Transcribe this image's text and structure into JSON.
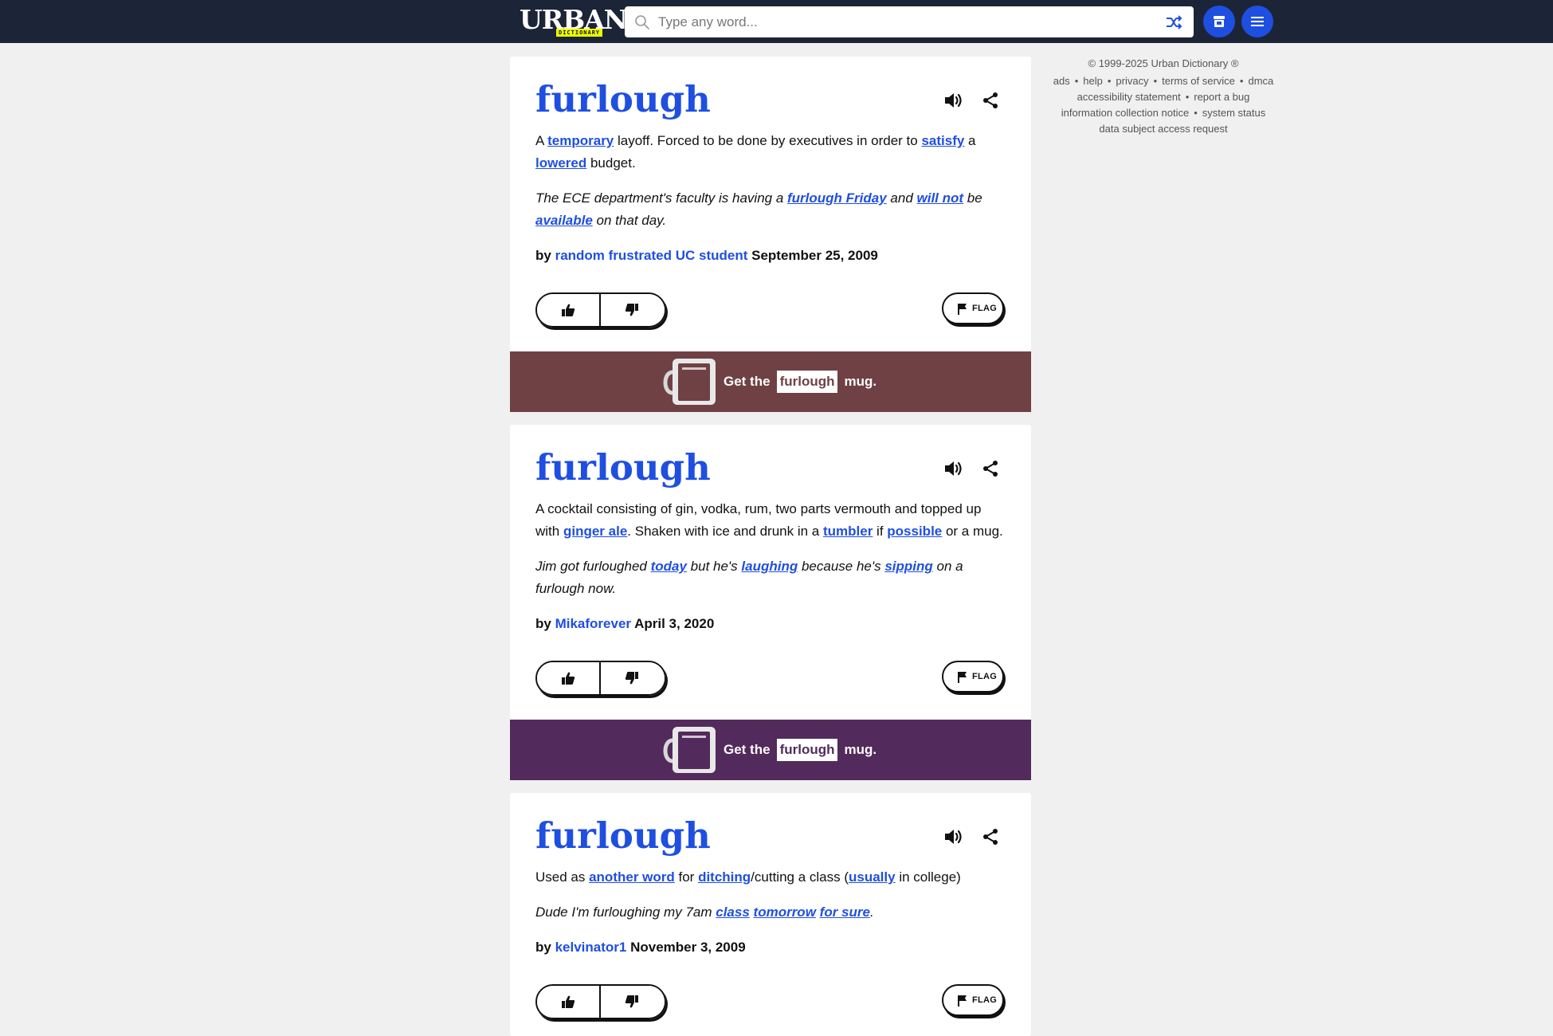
{
  "header": {
    "logo_text": "URBAN",
    "logo_sub": "DICTIONARY",
    "search_placeholder": "Type any word..."
  },
  "sidebar": {
    "copyright": "© 1999-2025 Urban Dictionary ®",
    "links": {
      "ads": "ads",
      "help": "help",
      "privacy": "privacy",
      "terms": "terms of service",
      "dmca": "dmca",
      "accessibility": "accessibility statement",
      "report_bug": "report a bug",
      "info_notice": "information collection notice",
      "system_status": "system status",
      "dsar": "data subject access request"
    },
    "separator": "•"
  },
  "definitions": [
    {
      "word": "furlough",
      "meaning": [
        {
          "t": "A "
        },
        {
          "link": "temporary"
        },
        {
          "t": " layoff. Forced to be done by executives in order to "
        },
        {
          "link": "satisfy"
        },
        {
          "t": " a "
        },
        {
          "link": "lowered"
        },
        {
          "t": " budget."
        }
      ],
      "example": [
        {
          "t": "The ECE department's faculty is having a "
        },
        {
          "link": "furlough Friday"
        },
        {
          "t": " and "
        },
        {
          "link": "will not"
        },
        {
          "t": " be "
        },
        {
          "link": "available"
        },
        {
          "t": " on that day."
        }
      ],
      "by": "by",
      "author": "random frustrated UC student",
      "date": "September 25, 2009",
      "flag_label": "FLAG",
      "mug": {
        "prefix": "Get the",
        "word": "furlough",
        "suffix": "mug.",
        "color": "#6f4144"
      }
    },
    {
      "word": "furlough",
      "meaning": [
        {
          "t": "A cocktail consisting of gin, vodka, rum, two parts vermouth and topped up with "
        },
        {
          "link": "ginger ale"
        },
        {
          "t": ". Shaken with ice and drunk in a "
        },
        {
          "link": "tumbler"
        },
        {
          "t": " if "
        },
        {
          "link": "possible"
        },
        {
          "t": " or a mug."
        }
      ],
      "example": [
        {
          "t": "Jim got furloughed "
        },
        {
          "link": "today"
        },
        {
          "t": " but he's "
        },
        {
          "link": "laughing"
        },
        {
          "t": " because he's "
        },
        {
          "link": "sipping"
        },
        {
          "t": " on a furlough now."
        }
      ],
      "by": "by",
      "author": "Mikaforever",
      "date": "April 3, 2020",
      "flag_label": "FLAG",
      "mug": {
        "prefix": "Get the",
        "word": "furlough",
        "suffix": "mug.",
        "color": "#532a5c"
      }
    },
    {
      "word": "furlough",
      "meaning": [
        {
          "t": "Used as "
        },
        {
          "link": "another word"
        },
        {
          "t": " for "
        },
        {
          "link": "ditching"
        },
        {
          "t": "/cutting a class ("
        },
        {
          "link": "usually"
        },
        {
          "t": " in college)"
        }
      ],
      "example": [
        {
          "t": "Dude I'm furloughing my 7am "
        },
        {
          "link": "class"
        },
        {
          "t": " "
        },
        {
          "link": "tomorrow"
        },
        {
          "t": " "
        },
        {
          "link": "for sure"
        },
        {
          "t": "."
        }
      ],
      "by": "by",
      "author": "kelvinator1",
      "date": "November 3, 2009",
      "flag_label": "FLAG"
    }
  ],
  "colors": {
    "accent": "#1f4fe0",
    "topbar": "#1c2438",
    "page_bg": "#f0f0f0"
  },
  "icons": [
    "search-icon",
    "shuffle-icon",
    "store-icon",
    "menu-icon",
    "speaker-icon",
    "share-icon",
    "thumbs-up-icon",
    "thumbs-down-icon",
    "flag-icon",
    "mug-icon"
  ]
}
